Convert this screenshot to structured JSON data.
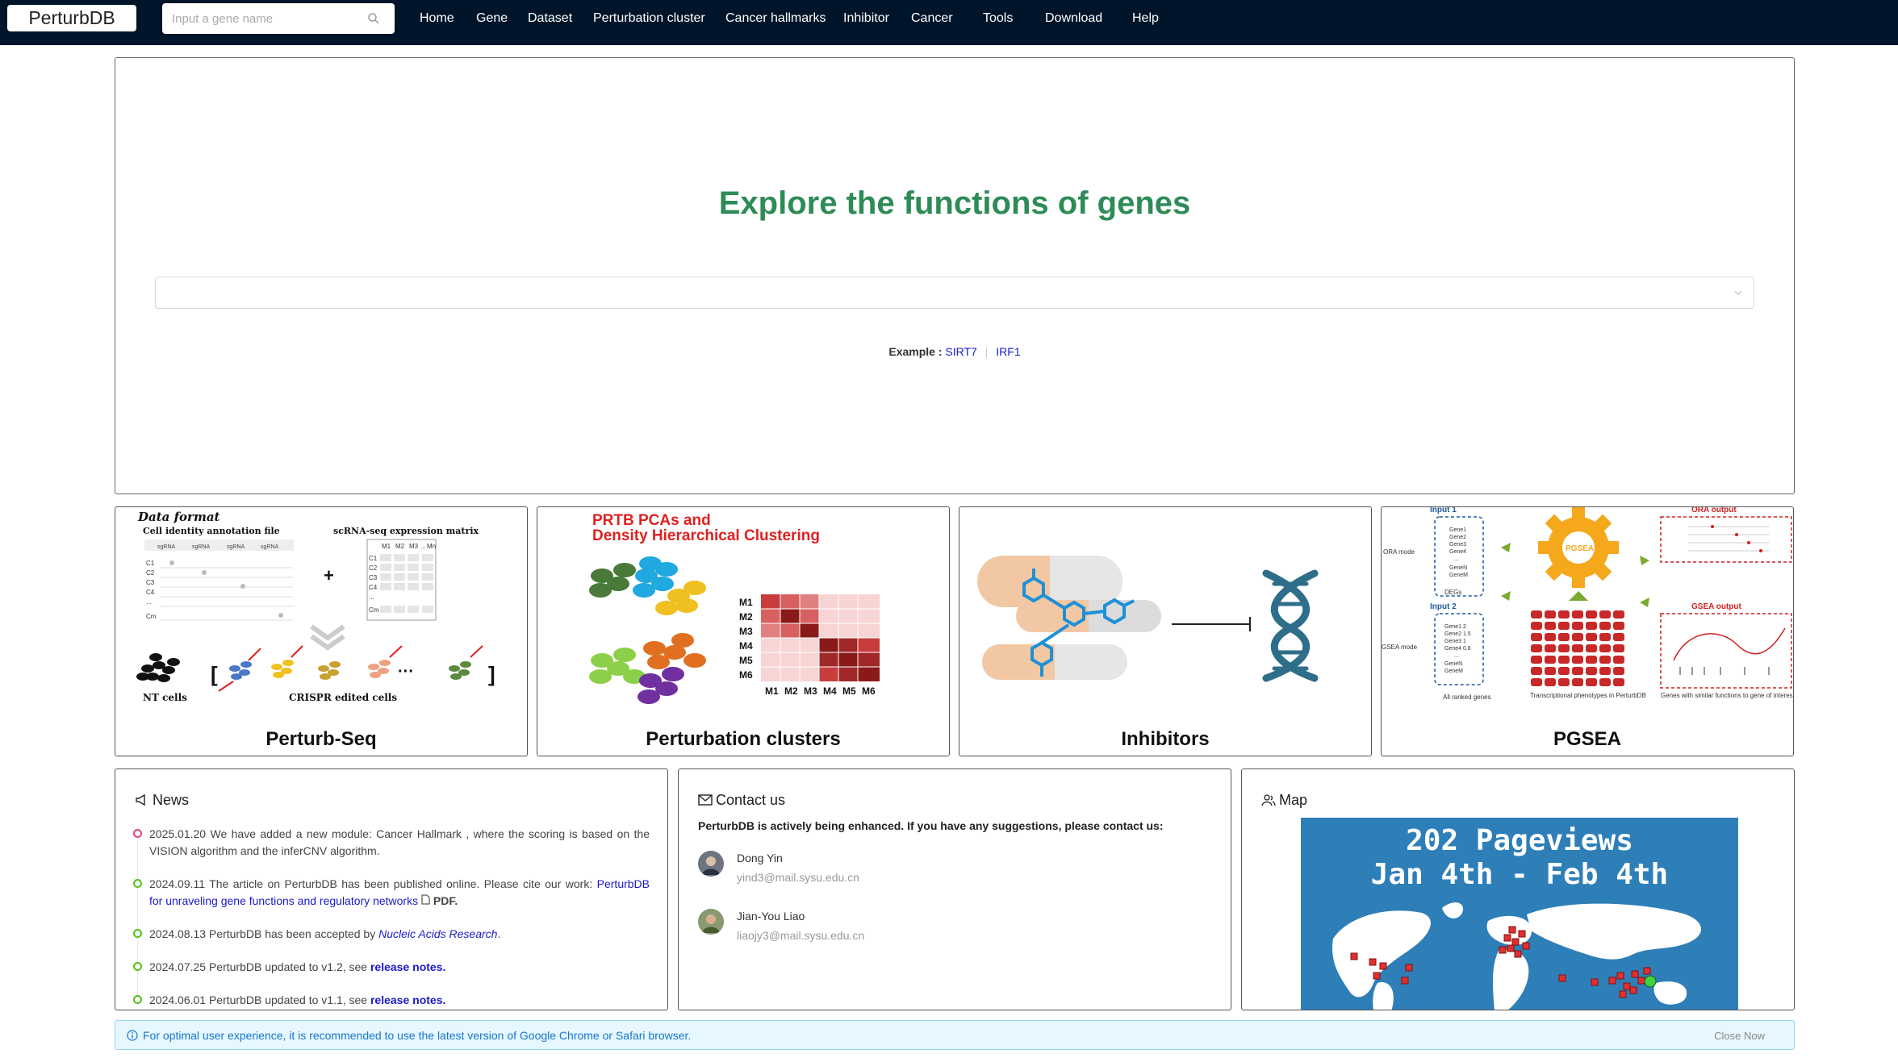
{
  "nav": {
    "brand": "PerturbDB",
    "search_placeholder": "Input a gene name",
    "items": [
      "Home",
      "Gene",
      "Dataset",
      "Perturbation cluster",
      "Cancer hallmarks",
      "Inhibitor",
      "Cancer",
      "Tools",
      "Download",
      "Help"
    ]
  },
  "hero": {
    "title": "Explore the functions of genes",
    "example_label": "Example :",
    "examples": [
      "SIRT7",
      "IRF1"
    ]
  },
  "cards": [
    {
      "caption": "Perturb-Seq",
      "art": {
        "heading": "Data format",
        "left_label": "Cell identity annotation file",
        "right_label": "scRNA-seq expression matrix",
        "sgrna_cols": [
          "sgRNA",
          "sgRNA",
          "sgRNA",
          "sgRNA"
        ],
        "rows": [
          "C1",
          "C2",
          "C3",
          "C4",
          "...",
          "Cm"
        ],
        "matrix_cols": [
          "M1",
          "M2",
          "M3",
          "...",
          "Mn"
        ],
        "nt_label": "NT cells",
        "crispr_label": "CRISPR edited cells"
      }
    },
    {
      "caption": "Perturbation clusters",
      "art": {
        "title_line1": "PRTB PCAs and",
        "title_line2": "Density Hierarchical Clustering",
        "modules": [
          "M1",
          "M2",
          "M3",
          "M4",
          "M5",
          "M6"
        ]
      }
    },
    {
      "caption": "Inhibitors",
      "art": {}
    },
    {
      "caption": "PGSEA",
      "art": {
        "input1": "Input 1",
        "input2": "Input 2",
        "ora_mode": "ORA mode",
        "gsea_mode": "GSEA mode",
        "genes1": [
          "Gene1",
          "Gene2",
          "Gene3",
          "Gene4",
          "...",
          "GeneN",
          "GeneM"
        ],
        "genes2": [
          "Gene1  2",
          "Gene2  1.5",
          "Gene3  1",
          "Gene4  0.8",
          "...",
          "GeneN",
          "GeneM"
        ],
        "degs": "DEGs",
        "ranked": "All ranked genes",
        "gear": "PGSEA",
        "phenotypes": "Transcriptional phenotypes in PerturbDB",
        "ora_output": "ORA output",
        "gsea_output": "GSEA output",
        "similar": "Genes with similar functions to gene of interest"
      }
    }
  ],
  "news": {
    "title": "News",
    "items": [
      {
        "date": "2025.01.20",
        "text": "We have added a new module: Cancer Hallmark , where the scoring is based on the VISION algorithm and the inferCNV algorithm."
      },
      {
        "date": "2024.09.11",
        "text": "The article on PerturbDB has been published online. Please cite our work:",
        "link": "PerturbDB for unraveling gene functions and regulatory networks",
        "suffix": "PDF."
      },
      {
        "date": "2024.08.13",
        "text": "PerturbDB has been accepted by",
        "journal": "Nucleic Acids Research",
        "suffix": "."
      },
      {
        "date": "2024.07.25",
        "text": "PerturbDB updated to v1.2, see",
        "link": "release notes."
      },
      {
        "date": "2024.06.01",
        "text": "PerturbDB updated to v1.1, see",
        "link": "release notes."
      }
    ]
  },
  "contact": {
    "title": "Contact us",
    "intro": "PerturbDB is actively being enhanced. If you have any suggestions, please contact us:",
    "people": [
      {
        "name": "Dong Yin",
        "email": "yind3@mail.sysu.edu.cn"
      },
      {
        "name": "Jian-You Liao",
        "email": "liaojy3@mail.sysu.edu.cn"
      }
    ]
  },
  "map": {
    "title": "Map",
    "line1": "202 Pageviews",
    "line2": "Jan 4th - Feb 4th"
  },
  "alert": {
    "message": "For optimal user experience, it is recommended to use the latest version of Google Chrome or Safari browser.",
    "close": "Close Now"
  },
  "colors": {
    "navbar": "#001529",
    "title_green": "#2e8b57",
    "link_blue": "#1a1acc",
    "timeline_green": "#52c41a",
    "alert_bg": "#e6f7ff",
    "map_blue": "#2e7fb8"
  }
}
